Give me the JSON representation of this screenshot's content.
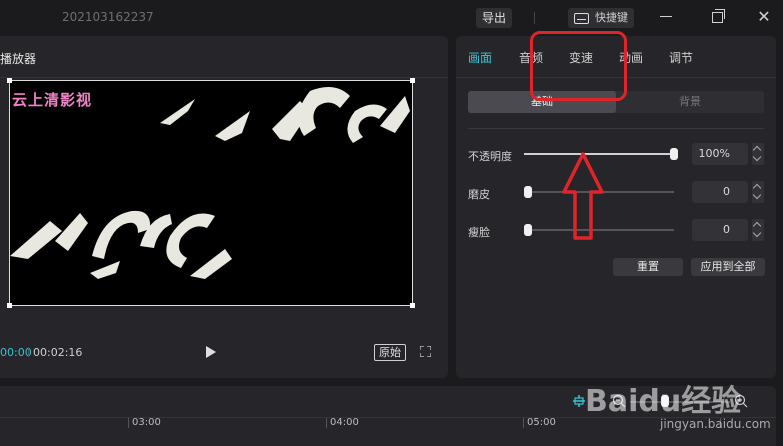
{
  "titlebar": {
    "title": "202103162237",
    "export_label": "导出",
    "shortcut_label": "快捷键",
    "close_glyph": "✕"
  },
  "player": {
    "title": "播放器",
    "watermark_overlay": "云上清影视",
    "time_current": "00:00",
    "time_total": "00:02:16",
    "original_label": "原始"
  },
  "inspector": {
    "tabs": [
      {
        "label": "画面",
        "active": true
      },
      {
        "label": "音频",
        "active": false
      },
      {
        "label": "变速",
        "active": false
      },
      {
        "label": "动画",
        "active": false
      },
      {
        "label": "调节",
        "active": false
      }
    ],
    "subtabs": {
      "basic": "基础",
      "background": "背景"
    },
    "opacity": {
      "label": "不透明度",
      "value": "100%",
      "level": 1.0
    },
    "smooth": {
      "label": "磨皮",
      "value": "0",
      "level": 0.0
    },
    "slim": {
      "label": "瘦脸",
      "value": "0",
      "level": 0.0
    },
    "reset_label": "重置",
    "apply_all_label": "应用到全部"
  },
  "timeline": {
    "labels": [
      "03:00",
      "04:00",
      "05:00"
    ],
    "zoom_level": 0.35
  },
  "annotation": {
    "color": "#e0242c"
  },
  "baidu_watermark": {
    "brand": "Baidu经验",
    "url": "jingyan.baidu.com"
  },
  "icons": [
    "keyboard-icon",
    "minimize-icon",
    "maximize-icon",
    "close-icon",
    "play-icon",
    "fullscreen-icon",
    "stepper-icon",
    "snap-icon",
    "zoom-out-icon",
    "zoom-in-icon"
  ],
  "colors": {
    "accent": "#35c7d9",
    "background": "#1b1b1e",
    "panel": "#26262a"
  }
}
